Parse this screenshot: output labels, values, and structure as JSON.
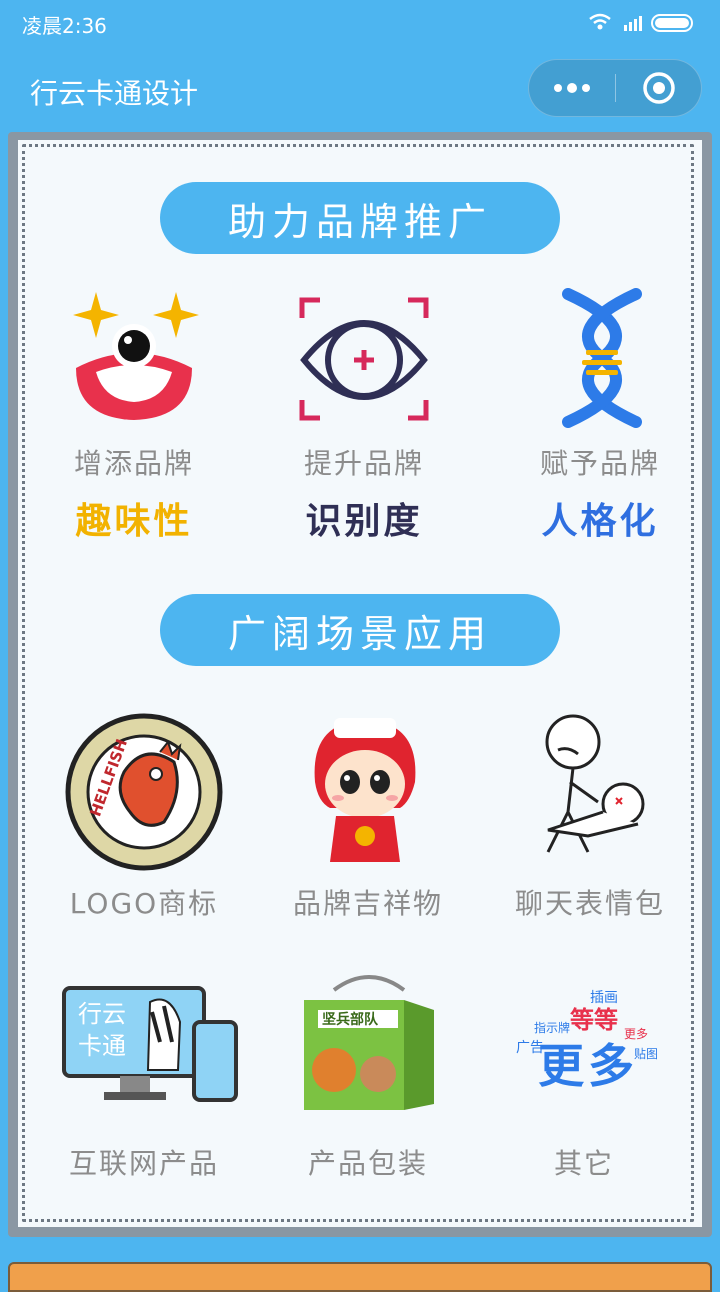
{
  "status": {
    "time": "凌晨2:36"
  },
  "nav": {
    "title": "行云卡通设计"
  },
  "sections": {
    "promo_title": "助力品牌推广",
    "scene_title": "广阔场景应用"
  },
  "features": [
    {
      "label": "增添品牌",
      "value": "趣味性",
      "color": "#f2b200"
    },
    {
      "label": "提升品牌",
      "value": "识别度",
      "color": "#2f2f55"
    },
    {
      "label": "赋予品牌",
      "value": "人格化",
      "color": "#2f6fe0"
    }
  ],
  "apps": [
    {
      "label": "LOGO商标"
    },
    {
      "label": "品牌吉祥物"
    },
    {
      "label": "聊天表情包"
    },
    {
      "label": "互联网产品"
    },
    {
      "label": "产品包装"
    },
    {
      "label": "其它"
    }
  ],
  "images": {
    "logo_text": "HELLFISH",
    "screen_text1": "行云",
    "screen_text2": "卡通",
    "box_text": "坚兵部队",
    "cloud_big1": "更",
    "cloud_big2": "多",
    "cloud_mid": "等等",
    "cloud_w1": "插画",
    "cloud_w2": "指示牌",
    "cloud_w3": "广告",
    "cloud_w4": "贴图",
    "cloud_w5": "更多"
  }
}
